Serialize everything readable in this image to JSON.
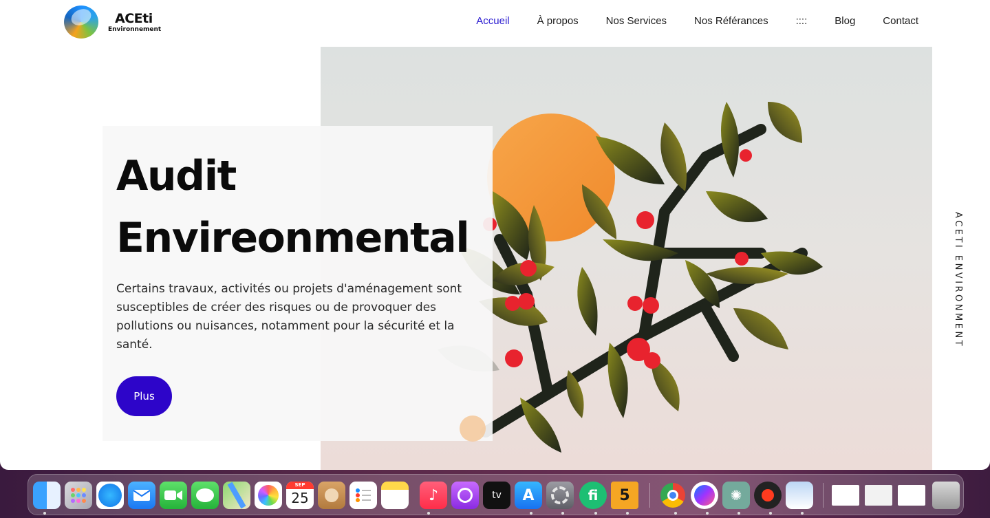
{
  "header": {
    "logo_name": "ACEti",
    "logo_sub": "Environnement",
    "nav": [
      {
        "label": "Accueil"
      },
      {
        "label": "À propos"
      },
      {
        "label": "Nos Services"
      },
      {
        "label": "Nos Référances"
      },
      {
        "label": "::::"
      },
      {
        "label": "Blog"
      },
      {
        "label": "Contact"
      }
    ]
  },
  "hero": {
    "title_line1": "Audit",
    "title_line2": "Envireonmental",
    "text": "Certains travaux, activités ou projets d'aménagement sont susceptibles de créer des risques ou de provoquer des pollutions ou nuisances, notamment pour la sécurité et la santé.",
    "button_label": "Plus",
    "side_label": "ACETI ENVIRONMENT"
  },
  "colors": {
    "accent": "#2d05c9",
    "nav_active": "#2a1bd0"
  },
  "dock": {
    "calendar_month": "SEP",
    "calendar_day": "25",
    "tv_label": "tv",
    "fiverr_label": "fi",
    "badge_label": "5",
    "items": [
      "finder-icon",
      "launchpad-icon",
      "safari-icon",
      "mail-icon",
      "facetime-icon",
      "messages-icon",
      "maps-icon",
      "photos-icon",
      "calendar-icon",
      "contacts-icon",
      "reminders-icon",
      "notes-icon",
      "music-icon",
      "podcasts-icon",
      "apple-tv-icon",
      "app-store-icon",
      "system-settings-icon",
      "fiverr-icon",
      "five-app-icon",
      "chrome-icon",
      "messenger-icon",
      "chatgpt-icon",
      "record-icon",
      "preview-icon",
      "window-thumbnail-1",
      "window-thumbnail-2",
      "window-thumbnail-3",
      "trash-icon"
    ]
  }
}
